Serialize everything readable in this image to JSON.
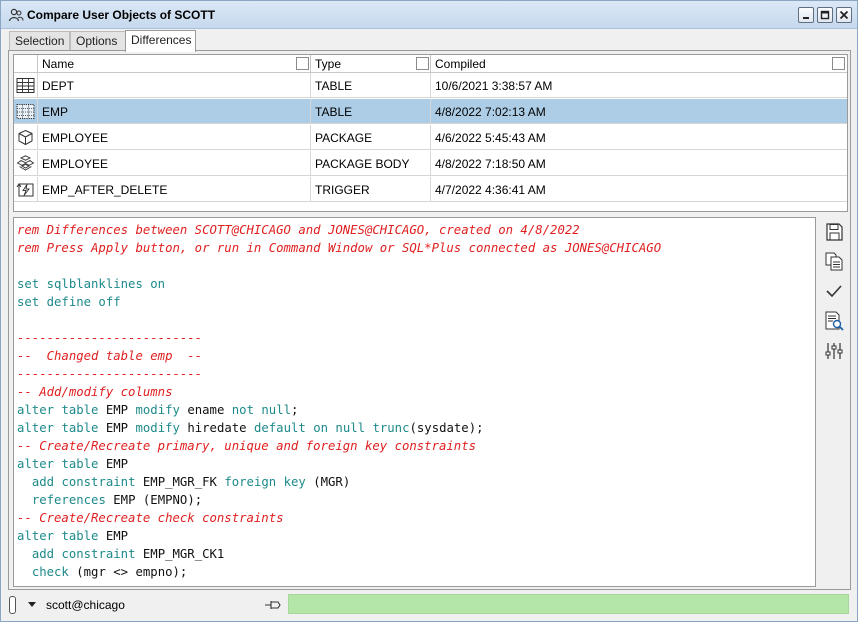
{
  "window": {
    "title": "Compare User Objects of SCOTT"
  },
  "tabs": [
    {
      "label": "Selection",
      "active": false
    },
    {
      "label": "Options",
      "active": false
    },
    {
      "label": "Differences",
      "active": true
    }
  ],
  "grid": {
    "columns": [
      "Name",
      "Type",
      "Compiled"
    ],
    "rows": [
      {
        "icon": "table-icon",
        "name": "DEPT",
        "type": "TABLE",
        "compiled": "10/6/2021 3:38:57 AM",
        "selected": false
      },
      {
        "icon": "table-icon",
        "name": "EMP",
        "type": "TABLE",
        "compiled": "4/8/2022 7:02:13 AM",
        "selected": true
      },
      {
        "icon": "package-icon",
        "name": "EMPLOYEE",
        "type": "PACKAGE",
        "compiled": "4/6/2022 5:45:43 AM",
        "selected": false
      },
      {
        "icon": "package-body-icon",
        "name": "EMPLOYEE",
        "type": "PACKAGE BODY",
        "compiled": "4/8/2022 7:18:50 AM",
        "selected": false
      },
      {
        "icon": "trigger-icon",
        "name": "EMP_AFTER_DELETE",
        "type": "TRIGGER",
        "compiled": "4/7/2022 4:36:41 AM",
        "selected": false
      }
    ]
  },
  "script": {
    "lines": [
      "rem Differences between SCOTT@CHICAGO and JONES@CHICAGO, created on 4/8/2022",
      "rem Press Apply button, or run in Command Window or SQL*Plus connected as JONES@CHICAGO",
      "",
      "set sqlblanklines on",
      "set define off",
      "",
      "-------------------------",
      "--  Changed table emp  --",
      "-------------------------",
      "-- Add/modify columns",
      "alter table EMP modify ename not null;",
      "alter table EMP modify hiredate default on null trunc(sysdate);",
      "-- Create/Recreate primary, unique and foreign key constraints",
      "alter table EMP",
      "  add constraint EMP_MGR_FK foreign key (MGR)",
      "  references EMP (EMPNO);",
      "-- Create/Recreate check constraints",
      "alter table EMP",
      "  add constraint EMP_MGR_CK1",
      "  check (mgr <> empno);"
    ]
  },
  "sidetools": [
    "save-icon",
    "copy-icon",
    "apply-check-icon",
    "find-icon",
    "settings-sliders-icon"
  ],
  "status": {
    "connection": "scott@chicago",
    "progress_percent": 100
  },
  "colors": {
    "selected_row": "#adcde6",
    "comment": "#e02020",
    "keyword": "#1e8a8a",
    "progress": "#b4e6a8"
  }
}
